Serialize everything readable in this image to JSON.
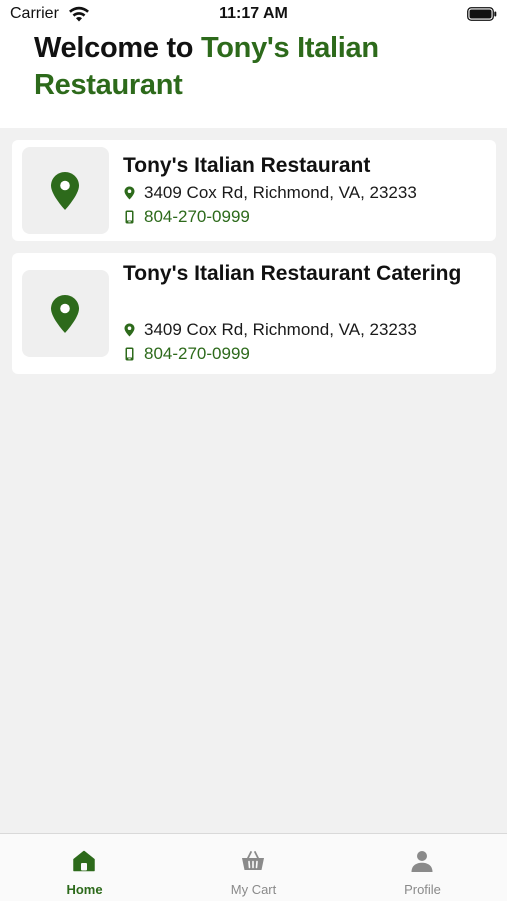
{
  "status_bar": {
    "carrier": "Carrier",
    "time": "11:17 AM",
    "wifi_icon": "wifi-icon",
    "battery_icon": "battery-icon"
  },
  "header": {
    "welcome_prefix": "Welcome to ",
    "restaurant_name": "Tony's Italian Restaurant"
  },
  "locations": [
    {
      "name": "Tony's Italian Restaurant",
      "address": "3409 Cox Rd, Richmond, VA, 23233",
      "phone": "804-270-0999",
      "icon": "map-pin-icon"
    },
    {
      "name": "Tony's Italian Restaurant Catering",
      "address": "3409 Cox Rd, Richmond, VA, 23233",
      "phone": "804-270-0999",
      "icon": "map-pin-icon"
    }
  ],
  "tab_bar": {
    "tabs": [
      {
        "label": "Home",
        "icon": "home-icon",
        "active": true
      },
      {
        "label": "My Cart",
        "icon": "basket-icon",
        "active": false
      },
      {
        "label": "Profile",
        "icon": "person-icon",
        "active": false
      }
    ]
  },
  "colors": {
    "accent_green": "#2d6a1b",
    "background": "#f1f1f1",
    "card": "#ffffff",
    "inactive_tab": "#8a8a8a"
  }
}
